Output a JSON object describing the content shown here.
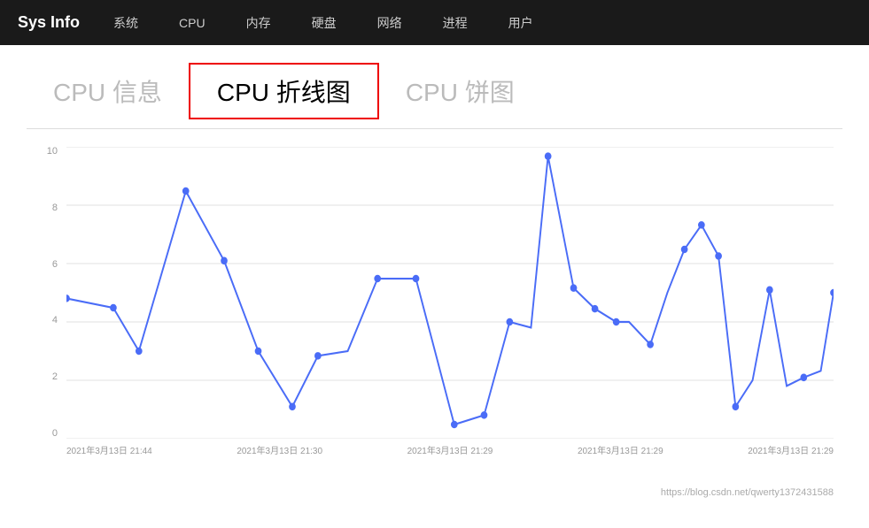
{
  "app": {
    "title": "Sys Info"
  },
  "navbar": {
    "items": [
      "系统",
      "CPU",
      "内存",
      "硬盘",
      "网络",
      "进程",
      "用户"
    ]
  },
  "tabs": [
    {
      "label": "CPU 信息",
      "active": false
    },
    {
      "label": "CPU 折线图",
      "active": true
    },
    {
      "label": "CPU 饼图",
      "active": false
    }
  ],
  "chart": {
    "y_labels": [
      "0",
      "2",
      "4",
      "6",
      "8",
      "10"
    ],
    "x_labels": [
      "2021年3月13日 21:44",
      "2021年3月13日 21:30",
      "2021年3月13日 21:29",
      "2021年3月13日 21:29",
      "2021年3月13日 21:29"
    ]
  },
  "watermark": "https://blog.csdn.net/qwerty1372431588"
}
